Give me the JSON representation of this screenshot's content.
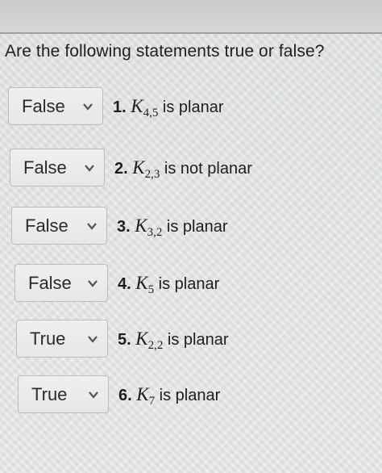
{
  "question": "Are the following statements true or false?",
  "items": [
    {
      "selected": "False",
      "number": "1.",
      "graph": "K",
      "subscript": "4,5",
      "statement": "is planar"
    },
    {
      "selected": "False",
      "number": "2.",
      "graph": "K",
      "subscript": "2,3",
      "statement": "is not planar"
    },
    {
      "selected": "False",
      "number": "3.",
      "graph": "K",
      "subscript": "3,2",
      "statement": "is planar"
    },
    {
      "selected": "False",
      "number": "4.",
      "graph": "K",
      "subscript": "5",
      "statement": "is planar"
    },
    {
      "selected": "True",
      "number": "5.",
      "graph": "K",
      "subscript": "2,2",
      "statement": "is planar"
    },
    {
      "selected": "True",
      "number": "6.",
      "graph": "K",
      "subscript": "7",
      "statement": "is planar"
    }
  ],
  "icons": {
    "dropdown": "chevron-down-icon"
  }
}
